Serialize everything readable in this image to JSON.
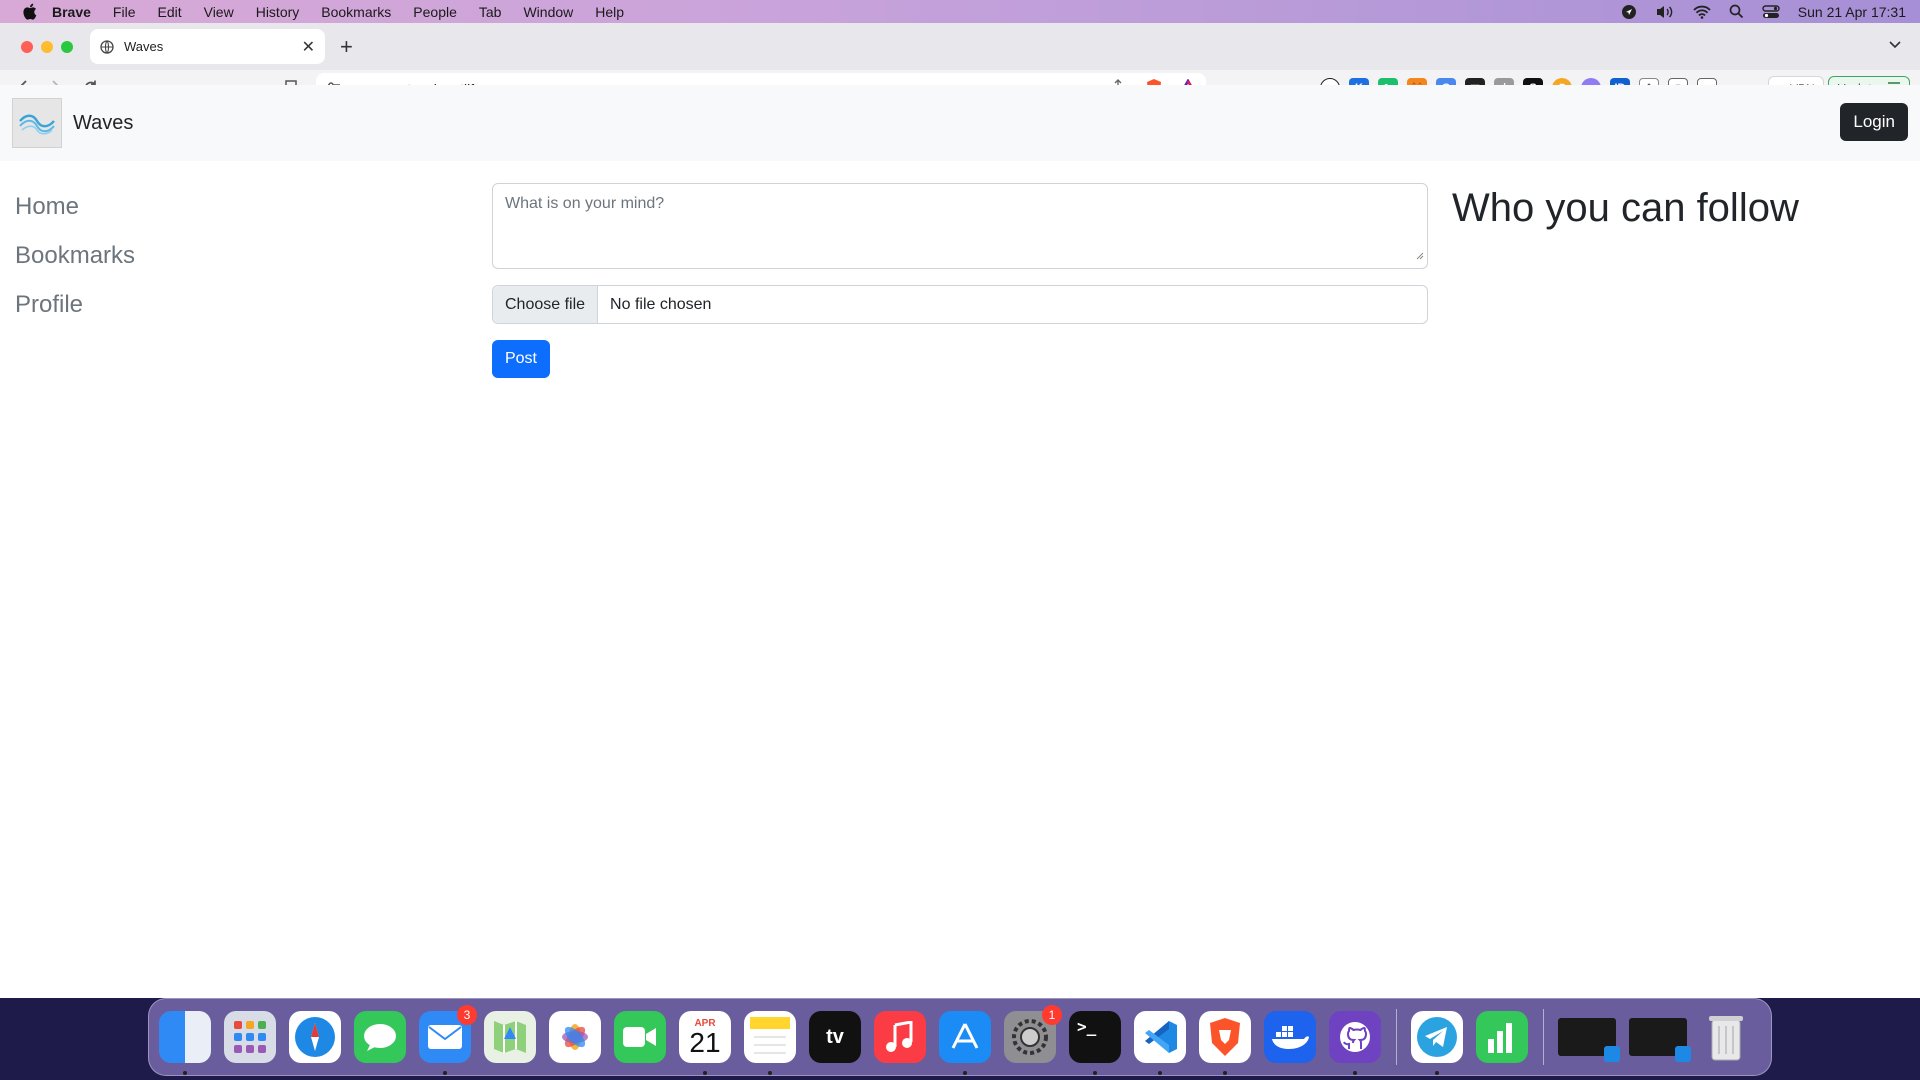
{
  "menubar": {
    "app_name": "Brave",
    "items": [
      "File",
      "Edit",
      "View",
      "History",
      "Bookmarks",
      "People",
      "Tab",
      "Window",
      "Help"
    ],
    "datetime": "Sun 21 Apr  17:31"
  },
  "browser": {
    "tab_title": "Waves",
    "url": "wavesnetwork.netlify.app",
    "vpn_label": "VPN",
    "update_label": "Update"
  },
  "navbar": {
    "brand": "Waves",
    "login_label": "Login"
  },
  "sidebar": {
    "items": [
      {
        "label": "Home"
      },
      {
        "label": "Bookmarks"
      },
      {
        "label": "Profile"
      }
    ]
  },
  "composer": {
    "placeholder": "What is on your mind?",
    "choose_file_label": "Choose file",
    "file_status": "No file chosen",
    "post_label": "Post"
  },
  "suggestions": {
    "heading": "Who you can follow"
  },
  "dock": {
    "mail_badge": "3",
    "calendar_month": "APR",
    "calendar_day": "21",
    "settings_badge": "1"
  }
}
